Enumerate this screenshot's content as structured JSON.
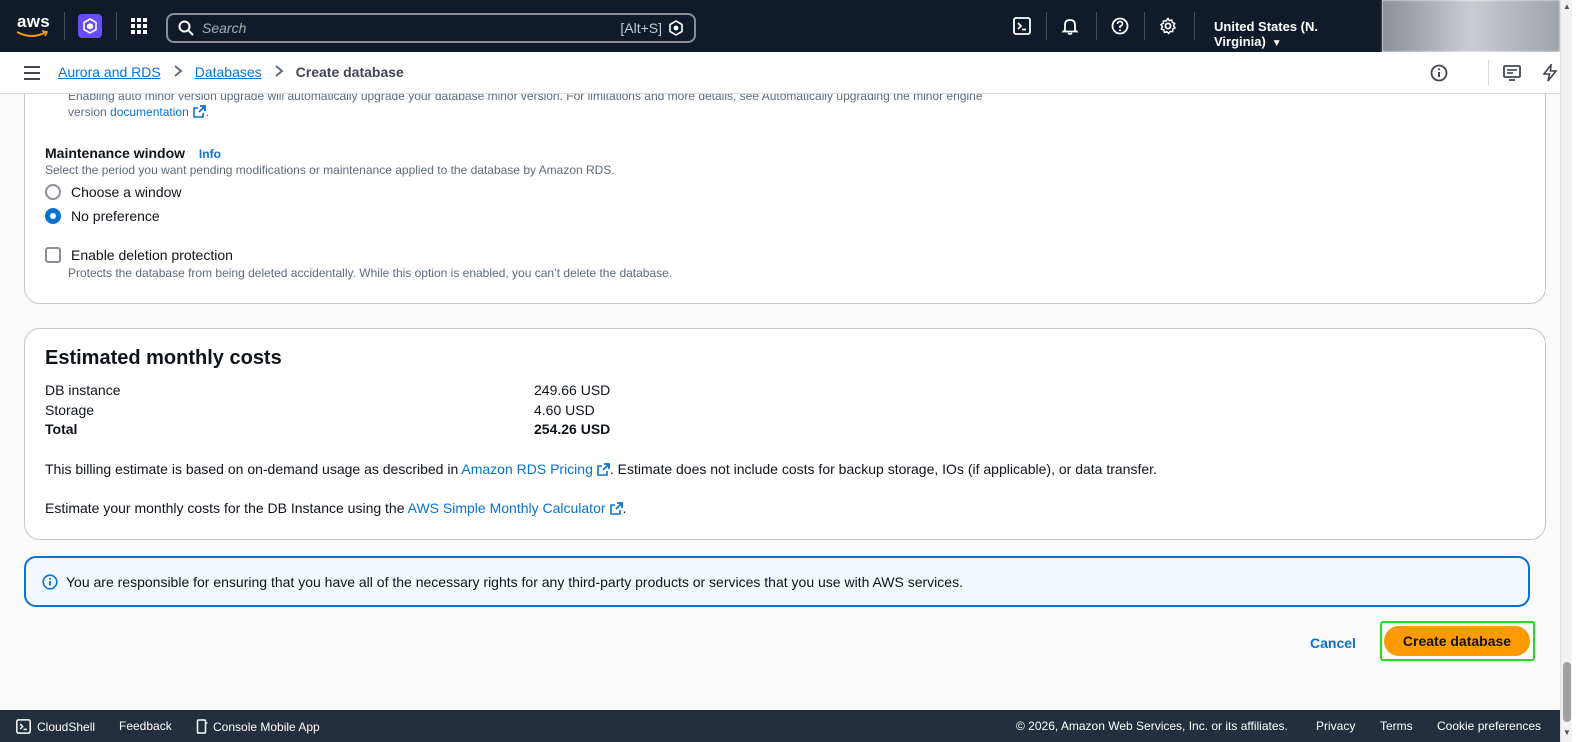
{
  "topnav": {
    "logo_text": "aws",
    "search_placeholder": "Search",
    "search_shortcut": "[Alt+S]",
    "region": "United States (N. Virginia)"
  },
  "breadcrumb": {
    "items": [
      "Aurora and RDS",
      "Databases"
    ],
    "current": "Create database"
  },
  "maintenance": {
    "auto_upgrade_text": "Enabling auto minor version upgrade will automatically upgrade your database minor version. For limitations and more details, see Automatically upgrading the minor engine",
    "auto_upgrade_text2": "version",
    "auto_upgrade_link": "documentation",
    "auto_upgrade_end": ".",
    "window_label": "Maintenance window",
    "info": "Info",
    "window_desc": "Select the period you want pending modifications or maintenance applied to the database by Amazon RDS.",
    "options": [
      "Choose a window",
      "No preference"
    ],
    "selected": "No preference",
    "deletion_label": "Enable deletion protection",
    "deletion_desc": "Protects the database from being deleted accidentally. While this option is enabled, you can’t delete the database.",
    "deletion_checked": false
  },
  "costs": {
    "title": "Estimated monthly costs",
    "rows": [
      {
        "label": "DB instance",
        "value": "249.66 USD"
      },
      {
        "label": "Storage",
        "value": "4.60 USD"
      },
      {
        "label": "Total",
        "value": "254.26 USD"
      }
    ],
    "billing_text_pre": "This billing estimate is based on on-demand usage as described in",
    "billing_link": "Amazon RDS Pricing",
    "billing_text_post": ". Estimate does not include costs for backup storage, IOs (if applicable), or data transfer.",
    "calc_text_pre": "Estimate your monthly costs for the DB Instance using the",
    "calc_link": "AWS Simple Monthly Calculator",
    "calc_text_post": "."
  },
  "alert": {
    "text": "You are responsible for ensuring that you have all of the necessary rights for any third-party products or services that you use with AWS services."
  },
  "actions": {
    "cancel": "Cancel",
    "create": "Create database"
  },
  "footer": {
    "cloudshell": "CloudShell",
    "feedback": "Feedback",
    "mobile_app": "Console Mobile App",
    "copyright": "© 2026, Amazon Web Services, Inc. or its affiliates.",
    "privacy": "Privacy",
    "terms": "Terms",
    "cookies": "Cookie preferences"
  },
  "colors": {
    "nav_bg": "#0f1b2a",
    "link": "#0972d3",
    "primary_button": "#ff9900",
    "footer_bg": "#232f3e"
  }
}
